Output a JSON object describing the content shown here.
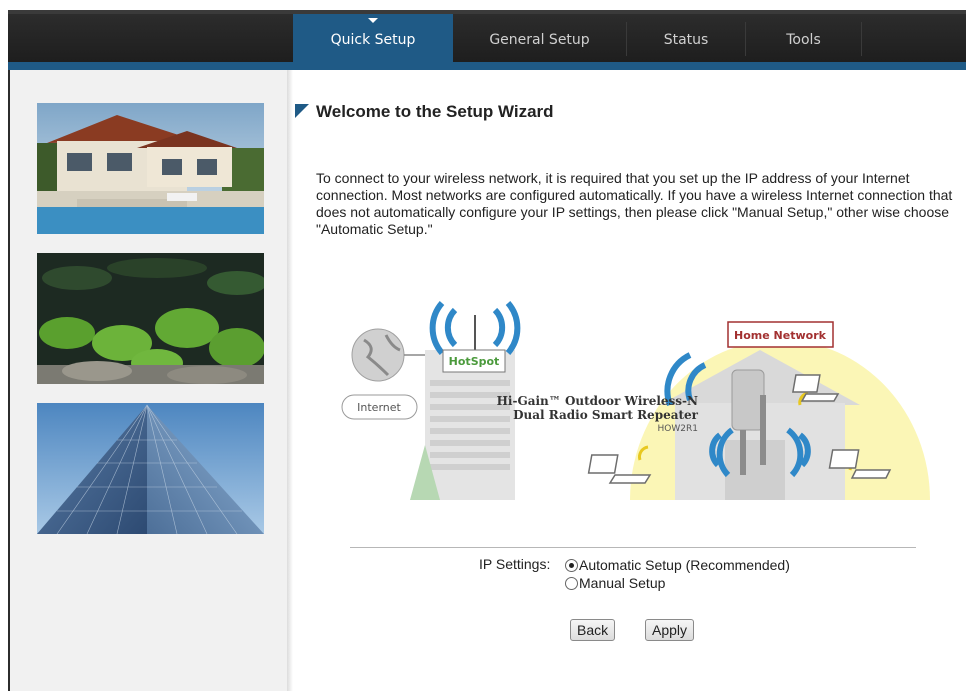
{
  "nav": {
    "tabs": [
      {
        "label": "Quick Setup",
        "active": true
      },
      {
        "label": "General Setup",
        "active": false
      },
      {
        "label": "Status",
        "active": false
      },
      {
        "label": "Tools",
        "active": false
      }
    ]
  },
  "main": {
    "title": "Welcome to the Setup Wizard",
    "intro": "To connect to your wireless network, it is required that you set up the IP address of your Internet connection. Most networks are configured automatically. If you have a wireless Internet connection that does not automatically configure your IP settings, then please click \"Manual Setup,\" other wise choose \"Automatic Setup.\""
  },
  "diagram": {
    "internet_label": "Internet",
    "hotspot_label": "HotSpot",
    "home_network_label": "Home Network",
    "product_line1": "Hi-Gain™ Outdoor Wireless-N",
    "product_line2": "Dual Radio Smart Repeater",
    "product_model": "HOW2R1"
  },
  "form": {
    "ip_settings_label": "IP Settings:",
    "options": [
      {
        "label": "Automatic Setup (Recommended)",
        "checked": true
      },
      {
        "label": "Manual Setup",
        "checked": false
      }
    ],
    "back_label": "Back",
    "apply_label": "Apply"
  },
  "colors": {
    "accent": "#1f5a86",
    "nav_bg": "#242424"
  }
}
